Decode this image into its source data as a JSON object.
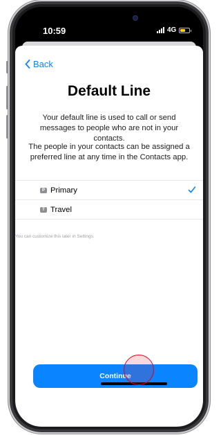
{
  "status_bar": {
    "time": "10:59",
    "network": "4G",
    "battery_color": "#ffd60a",
    "battery_level": 0.55,
    "signal_bars": 4
  },
  "nav": {
    "back_label": "Back",
    "back_icon": "chevron-left-icon"
  },
  "main": {
    "title": "Default Line",
    "description_1": "Your default line is used to call or send messages to people who are not in your contacts.",
    "description_2": "The people in your contacts can be assigned a preferred line at any time in the Contacts app."
  },
  "lines": [
    {
      "badge": "P",
      "label": "Primary",
      "selected": true
    },
    {
      "badge": "T",
      "label": "Travel",
      "selected": false
    }
  ],
  "footnote": "You can customize this later in Settings.",
  "continue_label": "Continue",
  "colors": {
    "accent": "#0a84ff",
    "click_marker": "#e0001b"
  }
}
